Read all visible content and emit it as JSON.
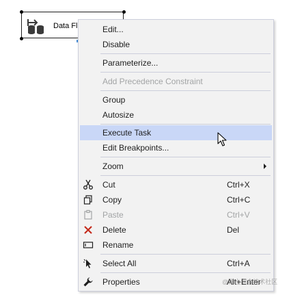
{
  "task": {
    "label": "Data Flo",
    "icon": "data-flow-task-icon"
  },
  "menu": {
    "items": [
      {
        "label": "Edit...",
        "shortcut": "",
        "icon": "",
        "disabled": false
      },
      {
        "label": "Disable",
        "shortcut": "",
        "icon": "",
        "disabled": false
      },
      {
        "label": "Parameterize...",
        "shortcut": "",
        "icon": "",
        "disabled": false
      },
      {
        "label": "Add Precedence Constraint",
        "shortcut": "",
        "icon": "",
        "disabled": true
      },
      {
        "label": "Group",
        "shortcut": "",
        "icon": "",
        "disabled": false
      },
      {
        "label": "Autosize",
        "shortcut": "",
        "icon": "",
        "disabled": false
      },
      {
        "label": "Execute Task",
        "shortcut": "",
        "icon": "",
        "disabled": false,
        "highlighted": true
      },
      {
        "label": "Edit Breakpoints...",
        "shortcut": "",
        "icon": "",
        "disabled": false
      },
      {
        "label": "Zoom",
        "shortcut": "",
        "icon": "",
        "disabled": false,
        "submenu": true
      },
      {
        "label": "Cut",
        "shortcut": "Ctrl+X",
        "icon": "scissors-icon",
        "disabled": false
      },
      {
        "label": "Copy",
        "shortcut": "Ctrl+C",
        "icon": "copy-icon",
        "disabled": false
      },
      {
        "label": "Paste",
        "shortcut": "Ctrl+V",
        "icon": "paste-icon",
        "disabled": true
      },
      {
        "label": "Delete",
        "shortcut": "Del",
        "icon": "delete-x-icon",
        "disabled": false
      },
      {
        "label": "Rename",
        "shortcut": "",
        "icon": "rename-icon",
        "disabled": false
      },
      {
        "label": "Select All",
        "shortcut": "Ctrl+A",
        "icon": "select-all-icon",
        "disabled": false
      },
      {
        "label": "Properties",
        "shortcut": "Alt+Enter",
        "icon": "wrench-icon",
        "disabled": false
      }
    ]
  },
  "colors": {
    "menu_background": "#f2f2f2",
    "highlight": "#c9d7f7",
    "disabled_text": "#a2a4a5",
    "delete_icon": "#c42b1c"
  },
  "watermark": "@稀土掘金技术社区"
}
